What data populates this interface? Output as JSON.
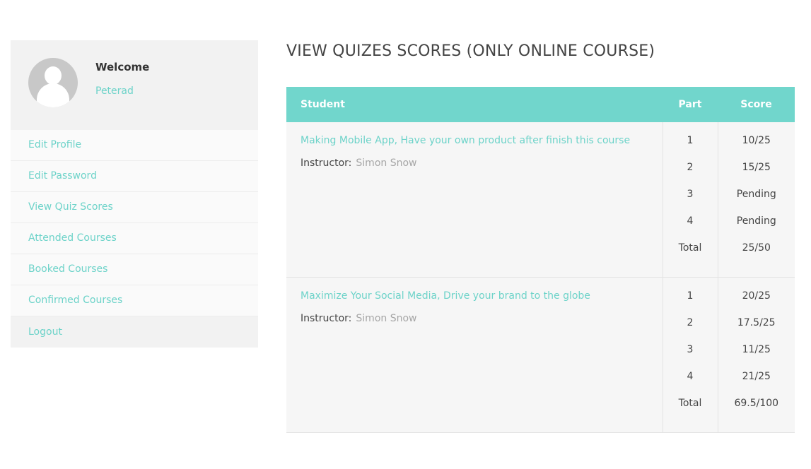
{
  "sidebar": {
    "welcome": "Welcome",
    "username": "Peterad",
    "avatar_icon": "user-avatar-icon",
    "menu": [
      "Edit Profile",
      "Edit Password",
      "View Quiz Scores",
      "Attended Courses",
      "Booked Courses",
      "Confirmed Courses",
      "Logout"
    ]
  },
  "main": {
    "title": "VIEW QUIZES SCORES (ONLY ONLINE COURSE)",
    "table": {
      "headers": {
        "student": "Student",
        "part": "Part",
        "score": "Score"
      },
      "instructor_label": "Instructor:",
      "rows": [
        {
          "course": "Making Mobile App, Have your own product after finish this course",
          "instructor": "Simon Snow",
          "parts": [
            "1",
            "2",
            "3",
            "4",
            "Total"
          ],
          "scores": [
            "10/25",
            "15/25",
            "Pending",
            "Pending",
            "25/50"
          ]
        },
        {
          "course": "Maximize Your Social Media, Drive your brand to the globe",
          "instructor": "Simon Snow",
          "parts": [
            "1",
            "2",
            "3",
            "4",
            "Total"
          ],
          "scores": [
            "20/25",
            "17.5/25",
            "11/25",
            "21/25",
            "69.5/100"
          ]
        }
      ]
    }
  },
  "colors": {
    "accent": "#6dd3c9",
    "header_bg": "#71d6cc",
    "panel_bg": "#f2f2f2",
    "muted_text": "#a6a6a6"
  }
}
